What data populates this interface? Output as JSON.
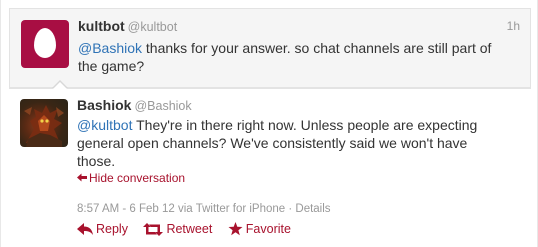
{
  "parent_tweet": {
    "fullname": "kultbot",
    "screenname": "@kultbot",
    "timestamp": "1h",
    "mention": "@Bashiok",
    "text_line1": " thanks for your answer. so chat channels are still part of",
    "text_line2": "the game?"
  },
  "main_tweet": {
    "fullname": "Bashiok",
    "screenname": "@Bashiok",
    "mention": "@kultbot",
    "text_line1": " They're in there right now. Unless people are expecting",
    "text_line2": "general open channels? We've consistently said we won't have",
    "text_line3": "those.",
    "hide_conversation": "Hide conversation",
    "meta": "8:57 AM - 6 Feb 12 via Twitter for iPhone · Details"
  },
  "actions": {
    "reply": "Reply",
    "retweet": "Retweet",
    "favorite": "Favorite"
  },
  "icons": {
    "avatar_kultbot": "egg-icon",
    "avatar_bashiok": "character-portrait",
    "hide": "arrow-left-icon",
    "reply": "reply-arrow-icon",
    "retweet": "retweet-icon",
    "favorite": "star-icon"
  },
  "colors": {
    "link": "#2f73b6",
    "action": "#a8122d",
    "muted": "#999999",
    "egg_bg": "#a80e43"
  }
}
